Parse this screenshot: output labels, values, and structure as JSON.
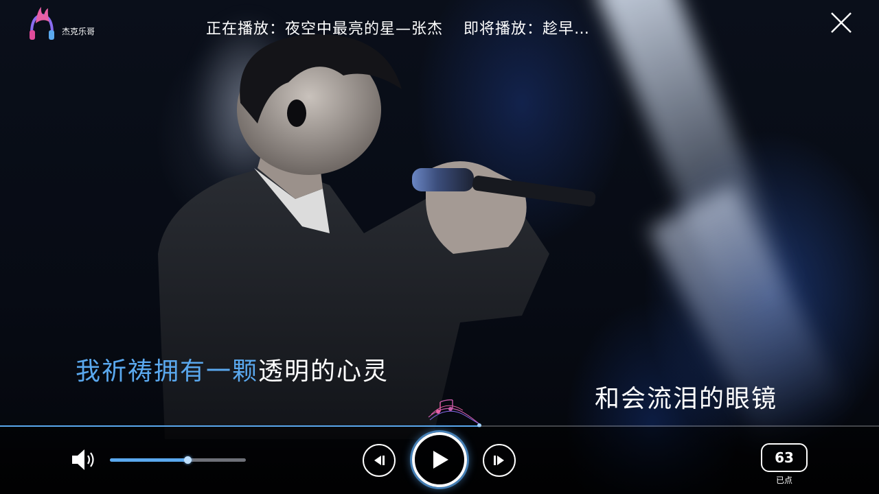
{
  "app": {
    "logo_text": "杰克乐哥",
    "logo_icon": "flame-headphones-icon"
  },
  "header": {
    "now_playing": "正在播放：夜空中最亮的星—张杰",
    "up_next": "即将播放：趁早…",
    "close_icon": "close-icon"
  },
  "lyrics": {
    "line1_sung": "我祈祷拥有一颗",
    "line1_unsung": "透明的心灵",
    "line2": "和会流泪的眼镜"
  },
  "playback": {
    "progress_fraction": 0.545,
    "volume_fraction": 0.57
  },
  "controls": {
    "volume_icon": "speaker-icon",
    "prev_icon": "previous-icon",
    "play_icon": "play-icon",
    "next_icon": "next-icon"
  },
  "queue": {
    "count": "63",
    "label": "已点"
  },
  "colors": {
    "accent": "#5aa8ee",
    "text": "#ffffff"
  }
}
